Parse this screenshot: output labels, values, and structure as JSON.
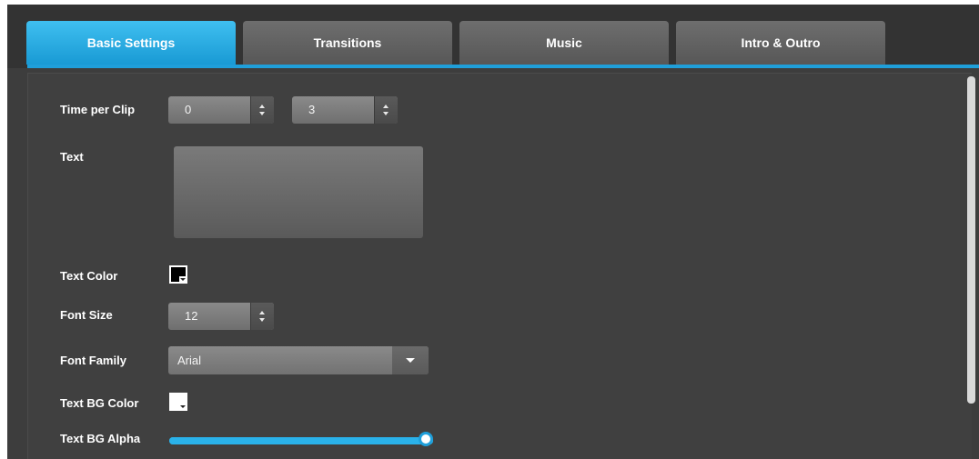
{
  "tabs": [
    {
      "label": "Basic Settings",
      "active": true
    },
    {
      "label": "Transitions",
      "active": false
    },
    {
      "label": "Music",
      "active": false
    },
    {
      "label": "Intro & Outro",
      "active": false
    }
  ],
  "settings": {
    "time_per_clip": {
      "label": "Time per Clip",
      "value_1": "0",
      "value_2": "3"
    },
    "text": {
      "label": "Text",
      "value": ""
    },
    "text_color": {
      "label": "Text Color",
      "color": "#000000"
    },
    "font_size": {
      "label": "Font Size",
      "value": "12"
    },
    "font_family": {
      "label": "Font Family",
      "value": "Arial"
    },
    "text_bg_color": {
      "label": "Text BG Color",
      "color": "#ffffff"
    },
    "text_bg_alpha": {
      "label": "Text BG Alpha",
      "value_fraction": 1.0
    }
  },
  "colors": {
    "accent": "#1f9fda",
    "background": "#404040"
  }
}
